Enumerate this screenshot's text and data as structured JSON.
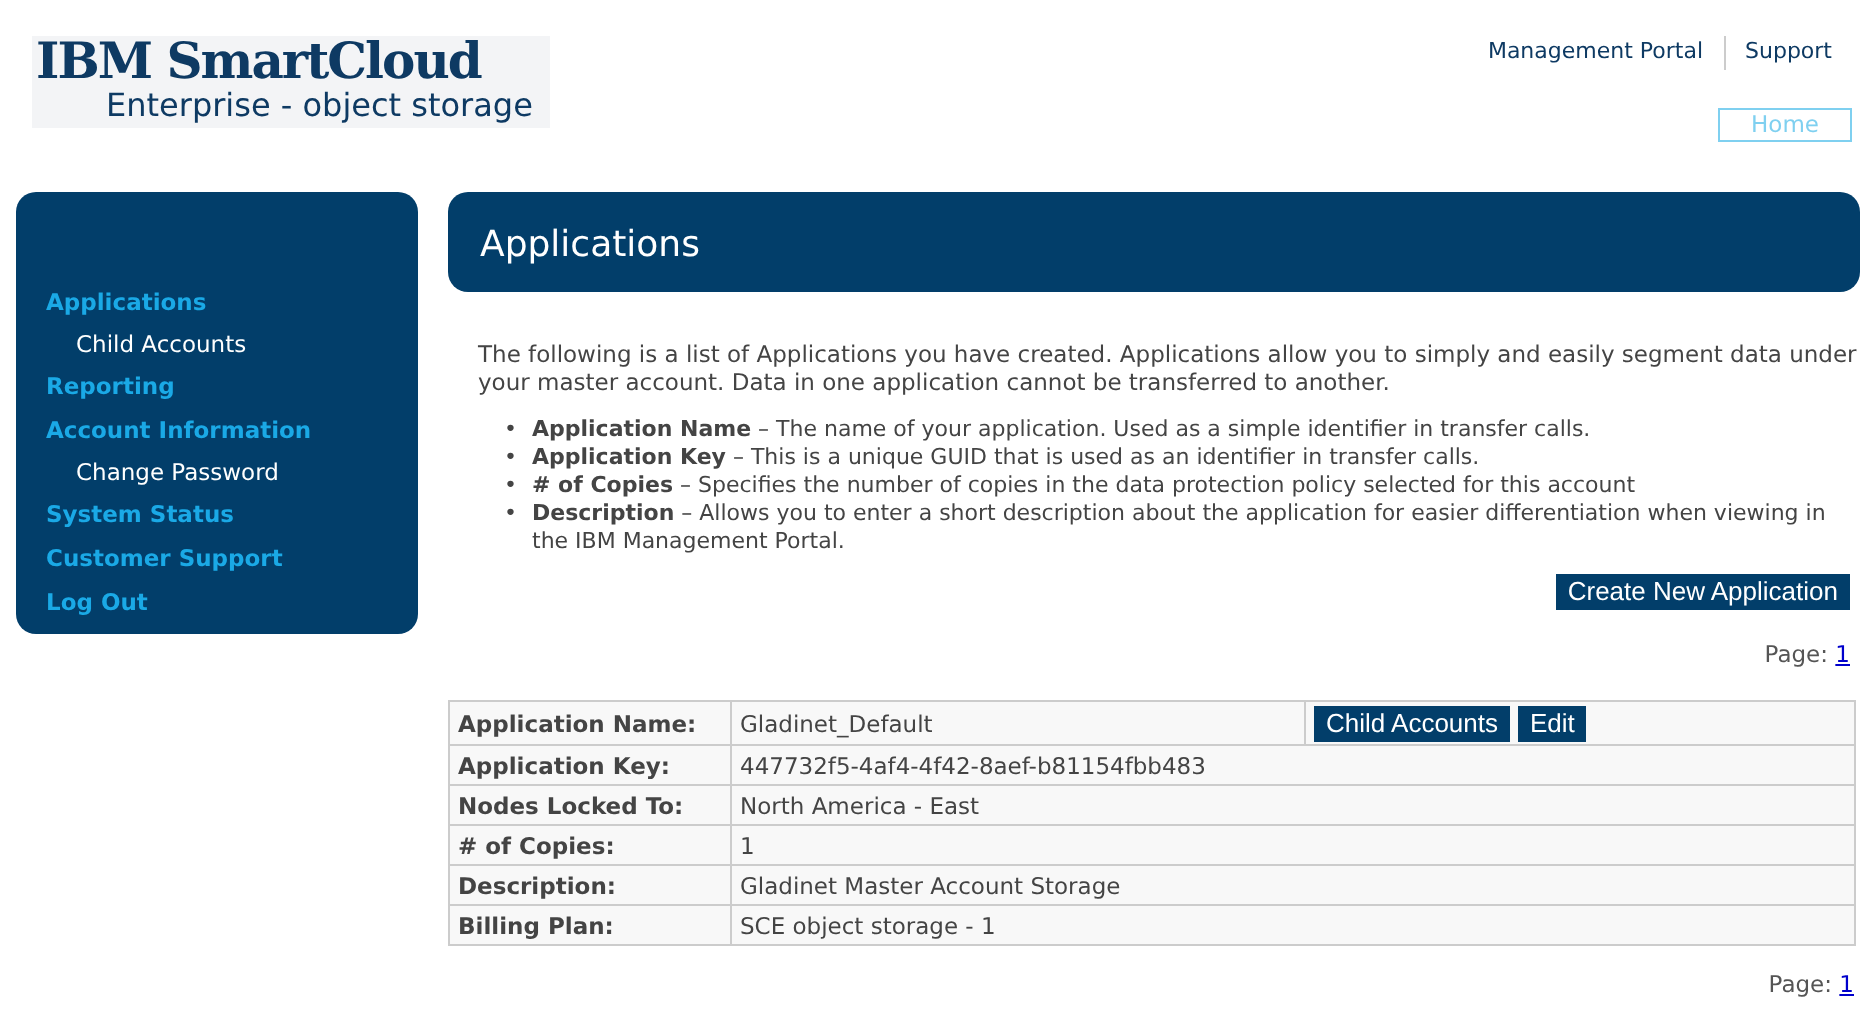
{
  "logo": {
    "title": "IBM SmartCloud",
    "subtitle": "Enterprise - object storage"
  },
  "top_links": [
    "Management Portal",
    "Support"
  ],
  "home_button": "Home",
  "sidebar": {
    "items": [
      {
        "label": "Applications",
        "children": [
          {
            "label": "Child Accounts"
          }
        ]
      },
      {
        "label": "Reporting"
      },
      {
        "label": "Account Information",
        "children": [
          {
            "label": "Change Password"
          }
        ]
      },
      {
        "label": "System Status"
      },
      {
        "label": "Customer Support"
      },
      {
        "label": "Log Out"
      }
    ]
  },
  "page_title": "Applications",
  "intro": "The following is a list of Applications you have created. Applications allow you to simply and easily segment data under your master account. Data in one application cannot be transferred to another.",
  "bullets": [
    {
      "marker": "•",
      "text": "**Application Name** – The name of your application. Used as a simple identifier in transfer calls."
    },
    {
      "marker": "•",
      "text": "**Application Key** – This is a unique GUID that is used as an identifier in transfer calls."
    },
    {
      "marker": "•",
      "text": "**# of Copies** – Specifies the number of copies in the data protection policy selected for this account"
    },
    {
      "marker": "•",
      "text": "**Description** – Allows you to enter a short description about the application for easier differentiation when viewing in the IBM Management Portal."
    }
  ],
  "create_button": "Create New Application",
  "pager_top": {
    "label": "Page:",
    "page": "1"
  },
  "details": [
    {
      "label": "Application Name:",
      "value": "Gladinet_Default",
      "actions": [
        "Child Accounts",
        "Edit"
      ]
    },
    {
      "label": "Application Key:",
      "value": "447732f5-4af4-4f42-8aef-b81154fbb483"
    },
    {
      "label": "Nodes Locked To:",
      "value": "North America - East"
    },
    {
      "label": "# of Copies:",
      "value": "1"
    },
    {
      "label": "Description:",
      "value": "Gladinet Master Account Storage"
    },
    {
      "label": "Billing Plan:",
      "value": "SCE object storage - 1"
    }
  ],
  "pager_bottom": {
    "label": "Page:",
    "page": "1"
  }
}
